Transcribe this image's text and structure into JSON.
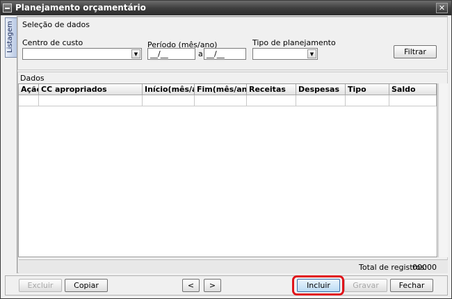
{
  "window": {
    "title": "Planejamento orçamentário",
    "close_glyph": "✕"
  },
  "sidetab": {
    "label": "Listagem"
  },
  "filters": {
    "section_title": "Seleção de dados",
    "cost_center_label": "Centro de custo",
    "cost_center_value": "",
    "period_label": "Período (mês/ano)",
    "period_start": "__/__",
    "period_sep": "a",
    "period_end": "__/__",
    "plan_type_label": "Tipo de planejamento",
    "plan_type_value": "",
    "filter_button": "Filtrar"
  },
  "data_section": {
    "title": "Dados",
    "columns": [
      "Ação",
      "CC apropriados",
      "Início(mês/ano)",
      "Fim(mês/ano)",
      "Receitas",
      "Despesas",
      "Tipo",
      "Saldo"
    ],
    "rows": [],
    "total_label": "Total de registros:",
    "total_value": "00000"
  },
  "actions": {
    "excluir": "Excluir",
    "copiar": "Copiar",
    "prev": "<",
    "next": ">",
    "incluir": "Incluir",
    "gravar": "Gravar",
    "fechar": "Fechar"
  },
  "icons": {
    "dropdown": "chevron-down-icon",
    "highlight_color": "#e0141a"
  }
}
